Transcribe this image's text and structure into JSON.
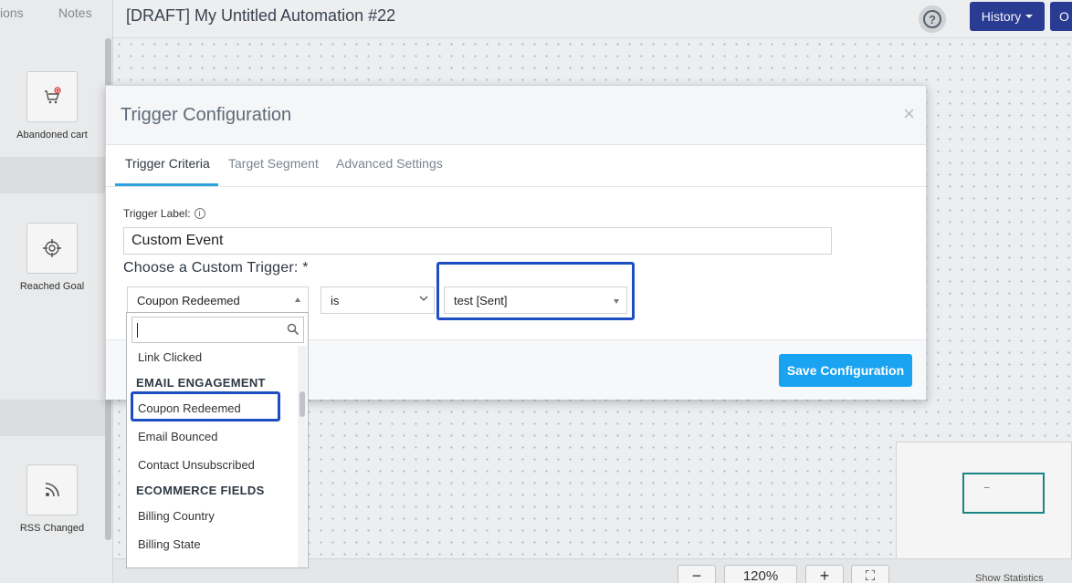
{
  "sidebar": {
    "tabs": [
      "ions",
      "Notes"
    ],
    "items": [
      {
        "label": "Abandoned cart",
        "icon": "cart-cancel-icon"
      },
      {
        "label": "Reached Goal",
        "icon": "target-icon"
      },
      {
        "label": "RSS Changed",
        "icon": "rss-icon"
      }
    ]
  },
  "header": {
    "title": "[DRAFT] My Untitled Automation #22",
    "help_label": "?",
    "history_label": "History",
    "o_label": "O"
  },
  "canvas": {
    "minimap_node_label": "–"
  },
  "bottombar": {
    "zoom_out": "−",
    "zoom_level": "120%",
    "zoom_in": "+",
    "fit": "⛶",
    "stats_label": "Show Statistics"
  },
  "modal": {
    "title": "Trigger Configuration",
    "close": "×",
    "tabs": [
      {
        "label": "Trigger Criteria",
        "active": true
      },
      {
        "label": "Target Segment",
        "active": false
      },
      {
        "label": "Advanced Settings",
        "active": false
      }
    ],
    "trigger_label_caption": "Trigger Label:",
    "trigger_label_value": "Custom Event",
    "choose_caption": "Choose a Custom Trigger: *",
    "trigger_select": "Coupon Redeemed",
    "operator_select": "is",
    "value_select": "test [Sent]",
    "save_label": "Save Configuration"
  },
  "dropdown": {
    "search_placeholder": "",
    "entries": [
      {
        "type": "item",
        "label": "Link Clicked"
      },
      {
        "type": "group",
        "label": "EMAIL ENGAGEMENT"
      },
      {
        "type": "item",
        "label": "Coupon Redeemed",
        "selected": true
      },
      {
        "type": "item",
        "label": "Email Bounced"
      },
      {
        "type": "item",
        "label": "Contact Unsubscribed"
      },
      {
        "type": "group",
        "label": "ECOMMERCE FIELDS"
      },
      {
        "type": "item",
        "label": "Billing Country"
      },
      {
        "type": "item",
        "label": "Billing State"
      }
    ]
  },
  "colors": {
    "primary_dark": "#2c3e99",
    "save_blue": "#1aa3f0",
    "highlight": "#1e4fc2",
    "tab_underline": "#2ba3e0"
  }
}
